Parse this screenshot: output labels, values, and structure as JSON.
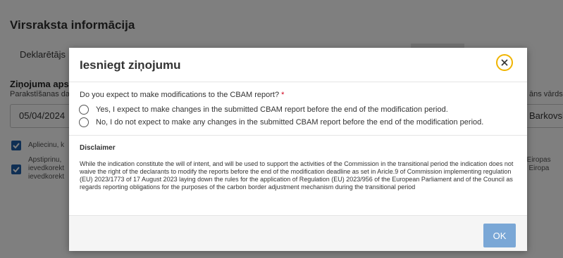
{
  "background": {
    "title": "Virsraksta informācija",
    "tab_label": "Deklarētājs",
    "section_title": "Ziņojuma aps",
    "field_label_left": "Parakstīšanas da",
    "field_label_right": "āns vārds u",
    "date_value": "05/04/2024",
    "name_value": "Barkovska",
    "check1_text": "Apliecinu, k",
    "check2_line1": "Apstiprinu,",
    "check2_line2": "ievedkorekt",
    "check2_line3": "ievedkorekt",
    "right_text_line1": "ar Eiropas",
    "right_text_line2": "rot Eiropa"
  },
  "modal": {
    "title": "Iesniegt ziņojumu",
    "question": "Do you expect to make modifications to the CBAM report?",
    "required_mark": "*",
    "options": [
      "Yes, I expect to make changes in the submitted CBAM report before the end of the modification period.",
      "No, I do not expect to make any changes in the submitted CBAM report before the end of the modification period."
    ],
    "disclaimer_title": "Disclaimer",
    "disclaimer_text": "While the indication constitute the will of intent, and will be used to support the activities of the Commission in the transitional period the indication does not waive the right of the declarants to modify the reports before the end of the modification deadline as set in Aricle.9 of Commission implementing regulation (EU) 2023/1773 of 17 August 2023 laying down the rules for the application of Regulation (EU) 2023/956 of the European Parliament and of the Council as regards reporting obligations for the purposes of the carbon border adjustment mechanism during the transitional period",
    "ok_label": "OK"
  },
  "colors": {
    "accent": "#1f5ea8",
    "close_ring": "#f0b400",
    "ok_button": "#7aa7d6",
    "required": "#d0021b"
  },
  "icons": {
    "close": "close-icon",
    "check": "checkmark-icon"
  }
}
